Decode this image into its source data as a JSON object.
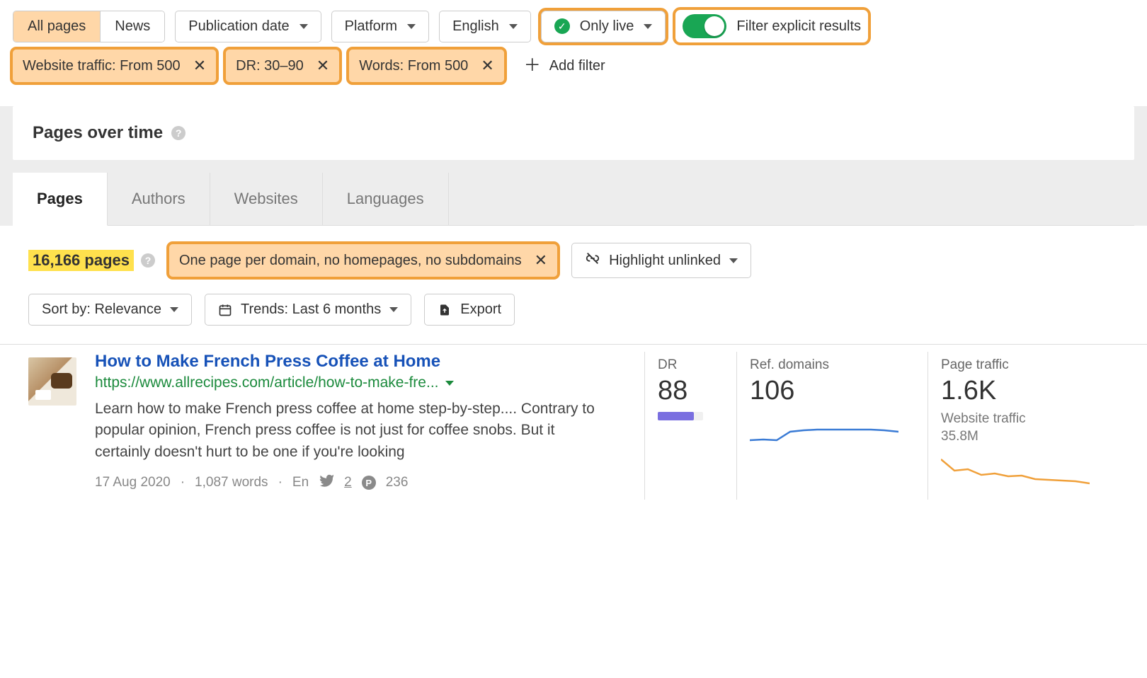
{
  "filters": {
    "segment": {
      "all": "All pages",
      "news": "News"
    },
    "publication_date": "Publication date",
    "platform": "Platform",
    "language": "English",
    "only_live": "Only live",
    "explicit_toggle": "Filter explicit results",
    "chips": [
      {
        "label": "Website traffic: From 500"
      },
      {
        "label": "DR: 30–90"
      },
      {
        "label": "Words: From 500"
      }
    ],
    "add_filter": "Add filter"
  },
  "panel_title": "Pages over time",
  "tabs": [
    "Pages",
    "Authors",
    "Websites",
    "Languages"
  ],
  "result_count": "16,166 pages",
  "domain_chip": "One page per domain, no homepages, no subdomains",
  "highlight_unlinked": "Highlight unlinked",
  "sort": "Sort by: Relevance",
  "trends": "Trends: Last 6 months",
  "export": "Export",
  "result": {
    "title": "How to Make French Press Coffee at Home",
    "url": "https://www.allrecipes.com/article/how-to-make-fre...",
    "desc": "Learn how to make French press coffee at home step-by-step.... Contrary to popular opinion, French press coffee is not just for coffee snobs. But it certainly doesn't hurt to be one if you're looking",
    "date": "17 Aug 2020",
    "words": "1,087 words",
    "lang": "En",
    "twitter": "2",
    "pinterest": "236",
    "dr_label": "DR",
    "dr": "88",
    "ref_label": "Ref. domains",
    "ref": "106",
    "pt_label": "Page traffic",
    "pt": "1.6K",
    "wt_label": "Website traffic",
    "wt": "35.8M"
  },
  "chart_data": [
    {
      "type": "line",
      "title": "Ref. domains trend",
      "x": [
        0,
        1,
        2,
        3,
        4,
        5,
        6,
        7,
        8,
        9,
        10,
        11
      ],
      "values": [
        60,
        62,
        61,
        78,
        80,
        81,
        82,
        82,
        82,
        82,
        80,
        78
      ],
      "ylim": [
        0,
        120
      ],
      "color": "#3A7BD5"
    },
    {
      "type": "line",
      "title": "Page traffic trend",
      "x": [
        0,
        1,
        2,
        3,
        4,
        5,
        6,
        7,
        8,
        9,
        10,
        11
      ],
      "values": [
        95,
        70,
        72,
        60,
        62,
        55,
        56,
        48,
        47,
        45,
        44,
        40
      ],
      "ylim": [
        0,
        100
      ],
      "color": "#F0A03A"
    }
  ]
}
